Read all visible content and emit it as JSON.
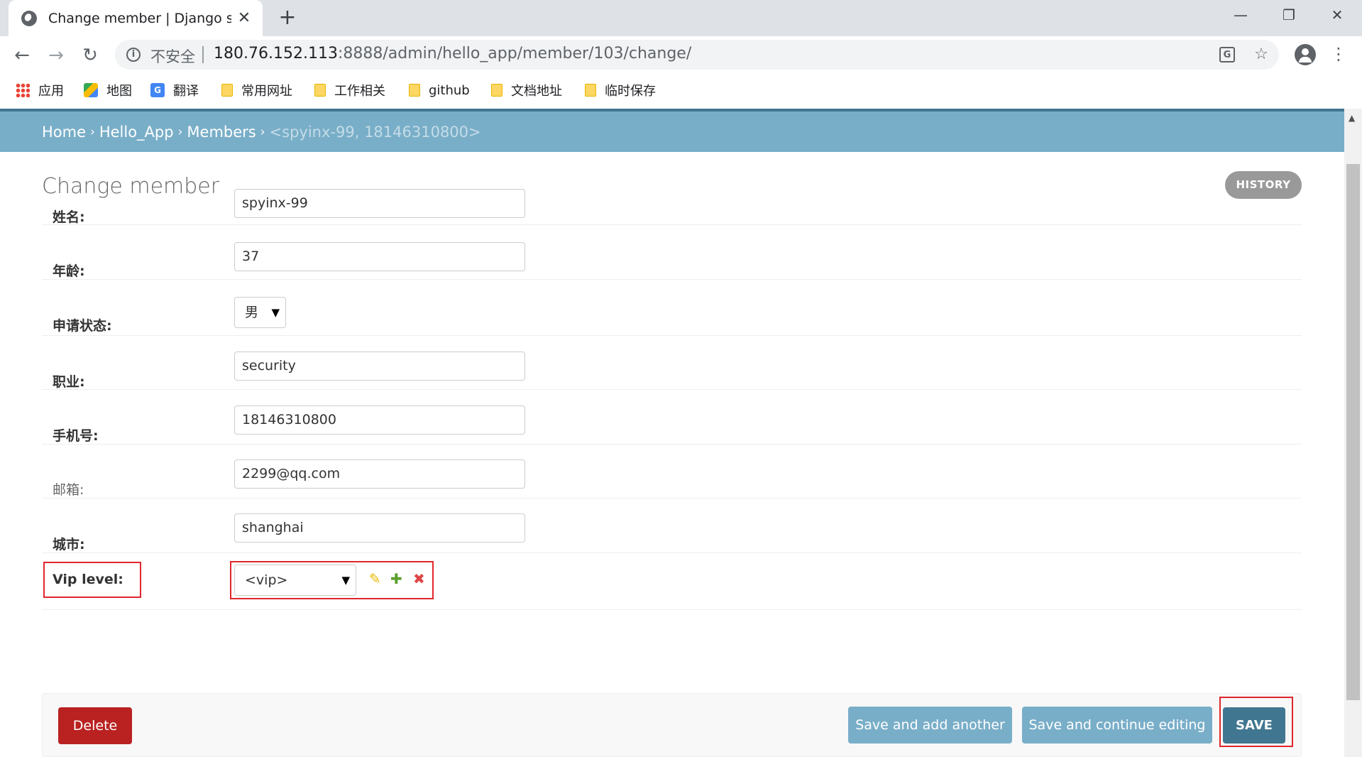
{
  "browser": {
    "tab_title": "Change member | Django site",
    "url_insecure_label": "不安全",
    "url_host": "180.76.152.113",
    "url_path": ":8888/admin/hello_app/member/103/change/",
    "bookmarks": [
      {
        "label": "应用",
        "icon": "apps-icon"
      },
      {
        "label": "地图",
        "icon": "map-icon"
      },
      {
        "label": "翻译",
        "icon": "translate-icon"
      },
      {
        "label": "常用网址",
        "icon": "folder-icon"
      },
      {
        "label": "工作相关",
        "icon": "folder-icon"
      },
      {
        "label": "github",
        "icon": "folder-icon"
      },
      {
        "label": "文档地址",
        "icon": "folder-icon"
      },
      {
        "label": "临时保存",
        "icon": "folder-icon"
      }
    ]
  },
  "breadcrumbs": {
    "home": "Home",
    "app": "Hello_App",
    "model": "Members",
    "current": "<spyinx-99, 18146310800>",
    "separator": "›"
  },
  "page": {
    "title": "Change member",
    "history_label": "HISTORY"
  },
  "form": {
    "name": {
      "label": "姓名:",
      "value": "spyinx-99"
    },
    "age": {
      "label": "年龄:",
      "value": "37"
    },
    "status": {
      "label": "申请状态:",
      "value": "男"
    },
    "job": {
      "label": "职业:",
      "value": "security"
    },
    "phone": {
      "label": "手机号:",
      "value": "18146310800"
    },
    "email": {
      "label": "邮箱:",
      "value": "2299@qq.com"
    },
    "city": {
      "label": "城市:",
      "value": "shanghai"
    },
    "vip": {
      "label": "Vip level:",
      "value": "<vip>"
    }
  },
  "related_icons": {
    "change": "✎",
    "add": "✚",
    "delete": "✖"
  },
  "actions": {
    "delete": "Delete",
    "save_add": "Save and add another",
    "save_continue": "Save and continue editing",
    "save": "SAVE"
  },
  "colors": {
    "header": "#79aec8",
    "header_border": "#417690",
    "delete": "#ba2121",
    "save": "#417690",
    "highlight": "#e0262c"
  }
}
